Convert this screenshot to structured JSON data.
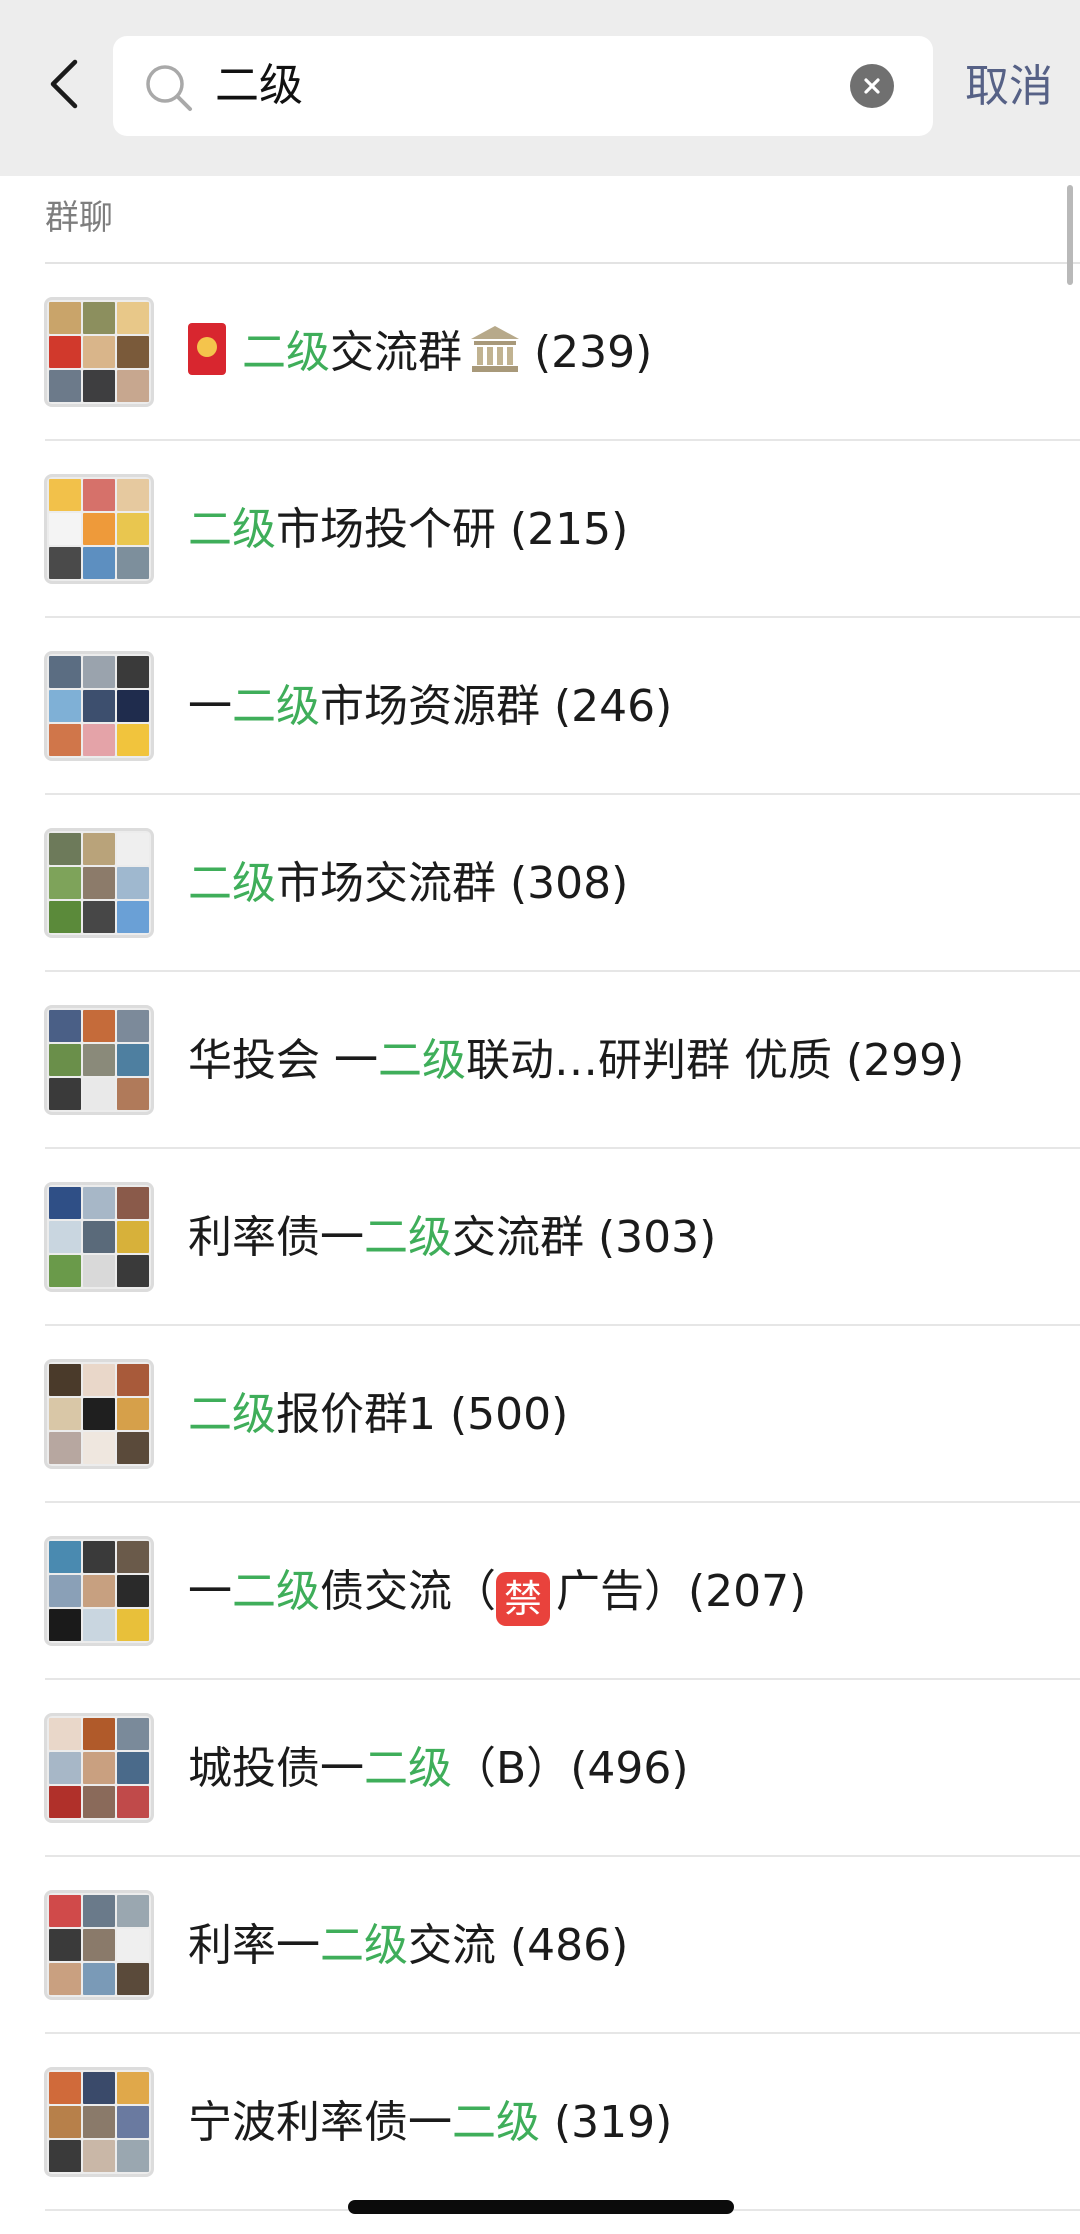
{
  "header": {
    "search_value": "二级",
    "cancel_label": "取消"
  },
  "section": {
    "title": "群聊"
  },
  "groups": [
    {
      "prefix": "",
      "keyword": "二级",
      "suffix": "交流群",
      "count": "(239)"
    },
    {
      "prefix": "",
      "keyword": "二级",
      "suffix": "市场投个研",
      "count": "(215)"
    },
    {
      "prefix": "一",
      "keyword": "二级",
      "suffix": "市场资源群",
      "count": "(246)"
    },
    {
      "prefix": "",
      "keyword": "二级",
      "suffix": "市场交流群",
      "count": "(308)"
    },
    {
      "prefix": "华投会 一",
      "keyword": "二级",
      "suffix": "联动…研判群 优质",
      "count": "(299)"
    },
    {
      "prefix": "利率债一",
      "keyword": "二级",
      "suffix": "交流群",
      "count": "(303)"
    },
    {
      "prefix": "",
      "keyword": "二级",
      "suffix": "报价群1",
      "count": "(500)"
    },
    {
      "prefix": "一",
      "keyword": "二级",
      "suffix": "债交流（",
      "badge": "禁",
      "suffix2": "广告）",
      "count": "(207)"
    },
    {
      "prefix": "城投债一",
      "keyword": "二级",
      "suffix": "（B）",
      "count": "(496)"
    },
    {
      "prefix": "利率一",
      "keyword": "二级",
      "suffix": "交流",
      "count": "(486)"
    },
    {
      "prefix": "宁波利率债一",
      "keyword": "二级",
      "suffix": "",
      "count": "(319)"
    }
  ],
  "icons": {
    "back": "chevron-left-icon",
    "search": "search-icon",
    "clear": "clear-circle-x-icon",
    "envelope": "red-envelope-emoji",
    "bank": "classical-building-emoji"
  },
  "colors": {
    "highlight": "#3fae5a",
    "header_bg": "#ededed",
    "cancel": "#566186"
  }
}
